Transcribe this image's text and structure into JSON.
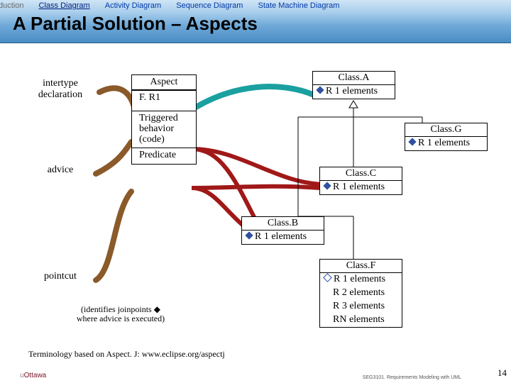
{
  "nav": {
    "items": [
      "Introduction",
      "Class Diagram",
      "Activity Diagram",
      "Sequence Diagram",
      "State Machine Diagram"
    ],
    "activeIndex": 1
  },
  "title": "A Partial Solution – Aspects",
  "clouds": {
    "intertype": "intertype declaration",
    "advice": "advice",
    "pointcut": "pointcut"
  },
  "aspect": {
    "header": "Aspect",
    "row_fr1": "F. R1",
    "row_trig": "Triggered behavior (code)",
    "row_pred": "Predicate"
  },
  "classes": {
    "A": {
      "name": "Class.A",
      "rows": [
        "R 1 elements"
      ]
    },
    "G": {
      "name": "Class.G",
      "rows": [
        "R 1 elements"
      ]
    },
    "C": {
      "name": "Class.C",
      "rows": [
        "R 1 elements"
      ]
    },
    "B": {
      "name": "Class.B",
      "rows": [
        "R 1 elements"
      ]
    },
    "F": {
      "name": "Class.F",
      "rows": [
        "R 1 elements",
        "R 2 elements",
        "R 3 elements",
        "RN elements"
      ]
    }
  },
  "pointcut_note": "(identifies joinpoints ◆\nwhere advice is executed)",
  "terminology": "Terminology based on Aspect. J: www.eclipse.org/aspectj",
  "course": "SEG3101. Requirements Modeling with UML",
  "logo": {
    "u": "u",
    "rest": "Ottawa"
  },
  "page": "14"
}
